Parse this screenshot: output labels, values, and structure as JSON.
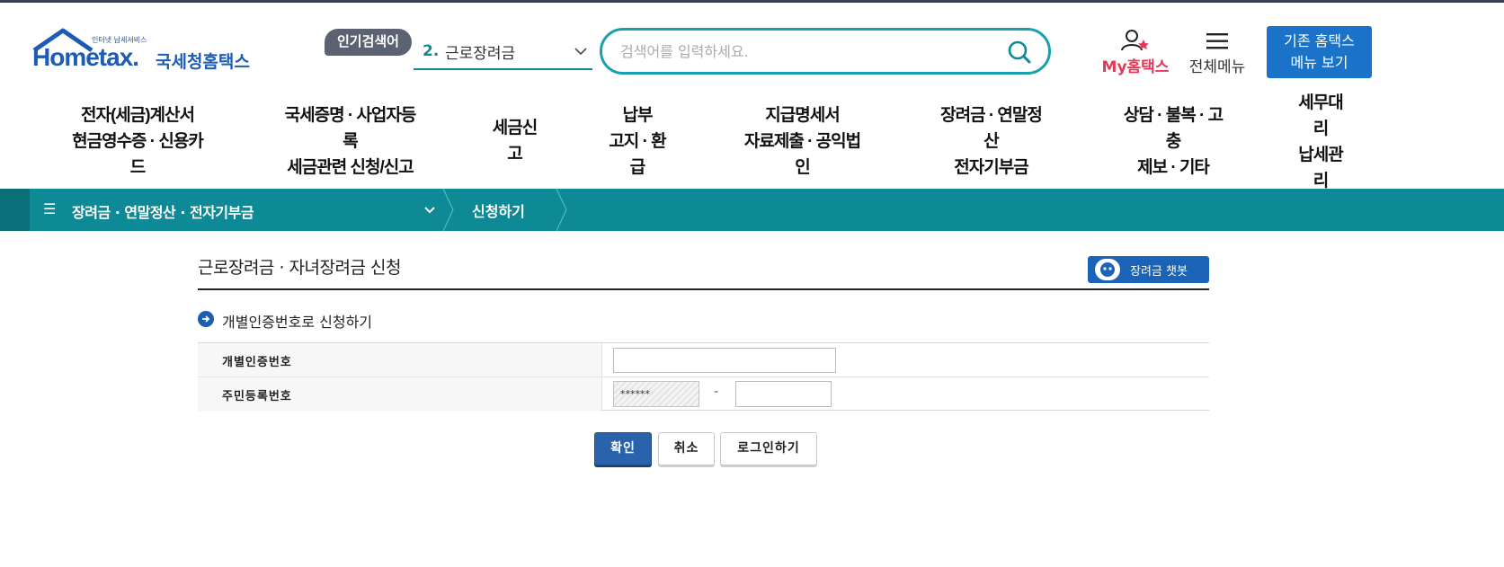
{
  "header": {
    "logo": {
      "tagline": "인터넷 납세서비스",
      "brand": "Hometax.",
      "brand_ko": "국세청홈택스"
    },
    "popular_badge": "인기검색어",
    "popular_rank": "2.",
    "popular_keyword": "근로장려금",
    "search": {
      "placeholder": "검색어를 입력하세요."
    },
    "my_hometax": "My홈택스",
    "all_menu": "전체메뉴",
    "old_hometax": {
      "line1": "기존 홈택스",
      "line2": "메뉴 보기"
    }
  },
  "gnb": [
    {
      "lines": [
        "전자(세금)계산서",
        "현금영수증 · 신용카",
        "드"
      ]
    },
    {
      "lines": [
        "국세증명 · 사업자등",
        "록",
        "세금관련 신청/신고"
      ]
    },
    {
      "lines": [
        "세금신",
        "고"
      ]
    },
    {
      "lines": [
        "납부",
        "고지 · 환",
        "급"
      ]
    },
    {
      "lines": [
        "지급명세서",
        "자료제출 · 공익법",
        "인"
      ]
    },
    {
      "lines": [
        "장려금 · 연말정",
        "산",
        "전자기부금"
      ]
    },
    {
      "lines": [
        "상담 · 불복 · 고",
        "충",
        "제보 · 기타"
      ]
    },
    {
      "lines": [
        "세무대",
        "리",
        "납세관",
        "리"
      ]
    }
  ],
  "breadcrumb": {
    "category": "장려금 · 연말정산 · 전자기부금",
    "current": "신청하기"
  },
  "page": {
    "title": "근로장려금 · 자녀장려금 신청",
    "chatbot_label": "장려금 챗봇",
    "section_title": "개별인증번호로 신청하기",
    "form": {
      "auth_no_label": "개별인증번호",
      "auth_no_value": "",
      "rrn_label": "주민등록번호",
      "rrn_front_mask": "******",
      "rrn_dash": "-",
      "rrn_back_value": ""
    },
    "buttons": {
      "confirm": "확인",
      "cancel": "취소",
      "login": "로그인하기"
    }
  },
  "colors": {
    "teal": "#0e8a96",
    "blue": "#1a73c9",
    "pink": "#e23a5a",
    "navy": "#2a62ab"
  }
}
